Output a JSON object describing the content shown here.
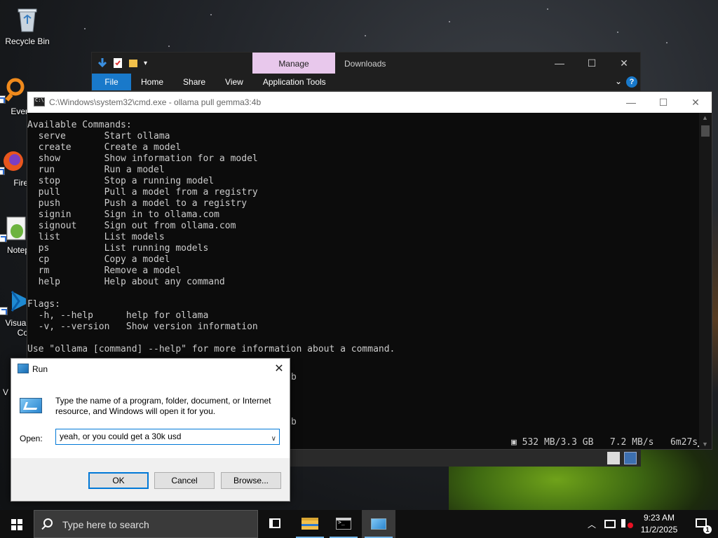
{
  "desktop": {
    "icons": [
      {
        "label": "Recycle Bin"
      },
      {
        "label": "Every"
      },
      {
        "label": "Fire"
      },
      {
        "label": "Notep"
      },
      {
        "label": "Visual"
      },
      {
        "label": "Co"
      },
      {
        "label": "V"
      }
    ]
  },
  "explorer": {
    "manage_tab": "Manage",
    "title": "Downloads",
    "ribbon_tabs": [
      "File",
      "Home",
      "Share",
      "View",
      "Application Tools"
    ],
    "help_label": "?"
  },
  "cmd": {
    "title": "C:\\Windows\\system32\\cmd.exe - ollama  pull gemma3:4b",
    "lines": [
      "Available Commands:",
      "  serve       Start ollama",
      "  create      Create a model",
      "  show        Show information for a model",
      "  run         Run a model",
      "  stop        Stop a running model",
      "  pull        Pull a model from a registry",
      "  push        Push a model to a registry",
      "  signin      Sign in to ollama.com",
      "  signout     Sign out from ollama.com",
      "  list        List models",
      "  ps          List running models",
      "  cp          Copy a model",
      "  rm          Remove a model",
      "  help        Help about any command",
      "",
      "Flags:",
      "  -h, --help      help for ollama",
      "  -v, --version   Show version information",
      "",
      "Use \"ollama [command] --help\" for more information about a command."
    ],
    "tail_chars": [
      "b",
      "b"
    ],
    "status": "532 MB/3.3 GB   7.2 MB/s   6m27s"
  },
  "run_dialog": {
    "title": "Run",
    "description": "Type the name of a program, folder, document, or Internet resource, and Windows will open it for you.",
    "open_label": "Open:",
    "input_value": "yeah, or you could get a 30k usd",
    "ok_label": "OK",
    "cancel_label": "Cancel",
    "browse_label": "Browse..."
  },
  "taskbar": {
    "search_placeholder": "Type here to search",
    "time": "9:23 AM",
    "date": "11/2/2025",
    "notification_count": "1"
  }
}
